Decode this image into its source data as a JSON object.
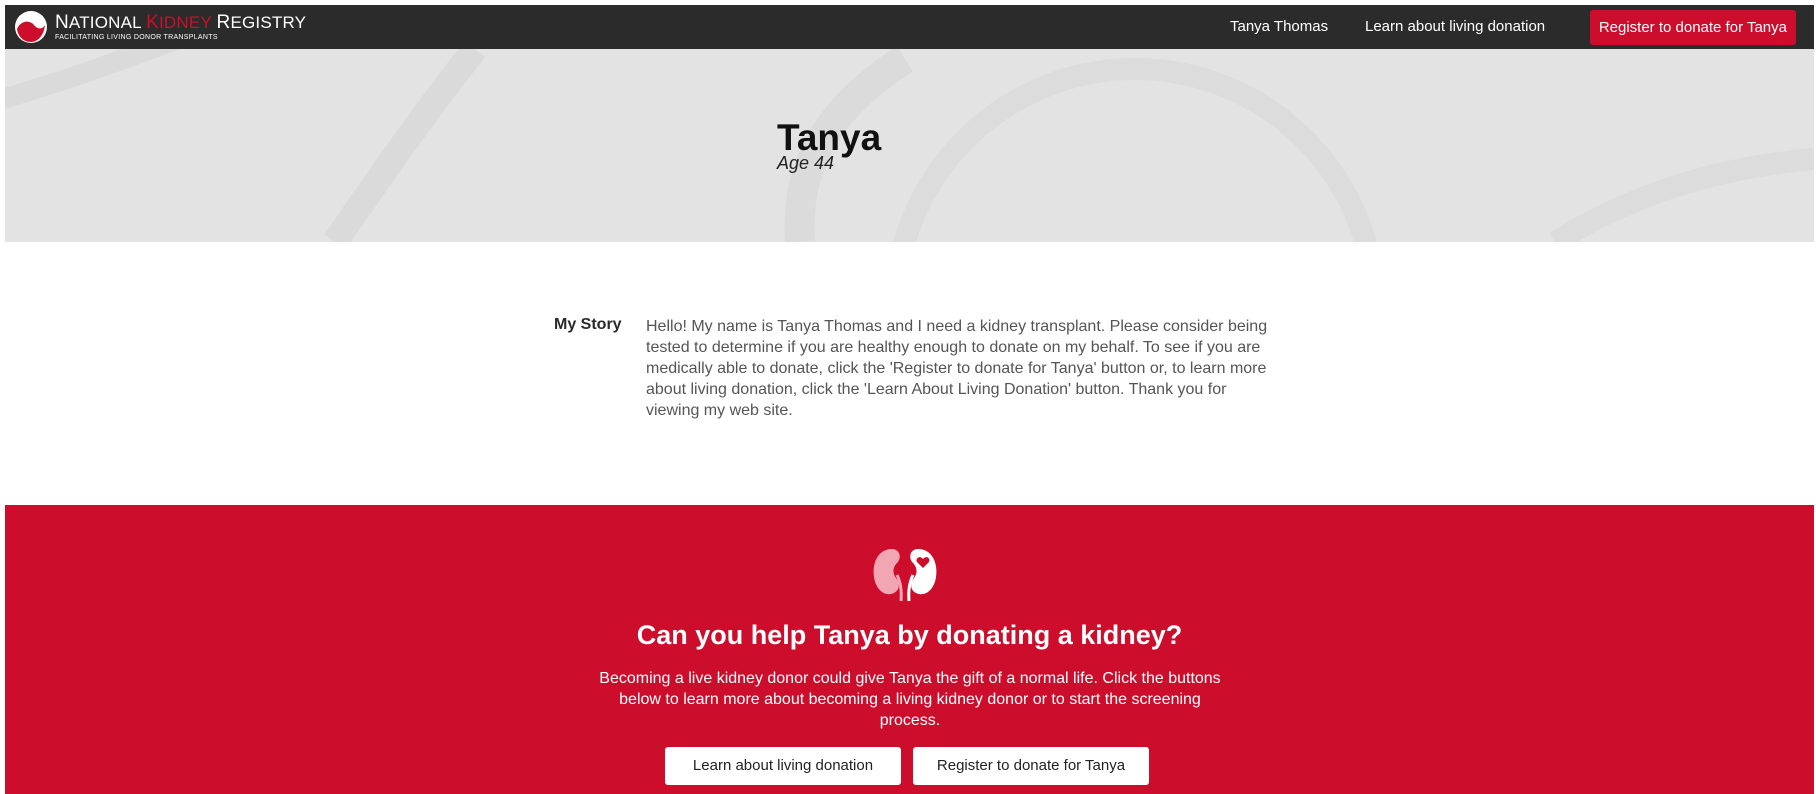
{
  "colors": {
    "brand_red": "#cc0e2c",
    "nav_bg": "#2b2b2b",
    "hero_bg": "#e3e3e3"
  },
  "logo": {
    "title_parts": [
      "N",
      "ATIONAL ",
      "K",
      "IDNEY ",
      "R",
      "EGISTRY"
    ],
    "subtitle": "FACILITATING LIVING DONOR TRANSPLANTS",
    "icon": "nkr-logo-icon"
  },
  "nav": {
    "user_name": "Tanya Thomas",
    "learn_label": "Learn about living donation",
    "register_label": "Register to donate for Tanya"
  },
  "hero": {
    "name": "Tanya",
    "age": "Age 44"
  },
  "story": {
    "label": "My Story",
    "text": "Hello! My name is Tanya Thomas and I need a kidney transplant. Please consider being tested to determine if you are healthy enough to donate on my behalf. To see if you are medically able to donate, click the 'Register to donate for Tanya' button or, to learn more about living donation, click the 'Learn About Living Donation' button. Thank you for viewing my web site."
  },
  "cta": {
    "icon": "kidneys-heart-icon",
    "title": "Can you help Tanya by donating a kidney?",
    "text": "Becoming a live kidney donor could give Tanya the gift of a normal life. Click the buttons below to learn more about becoming a living kidney donor or to start the screening process.",
    "learn_button": "Learn about living donation",
    "register_button": "Register to donate for Tanya"
  }
}
